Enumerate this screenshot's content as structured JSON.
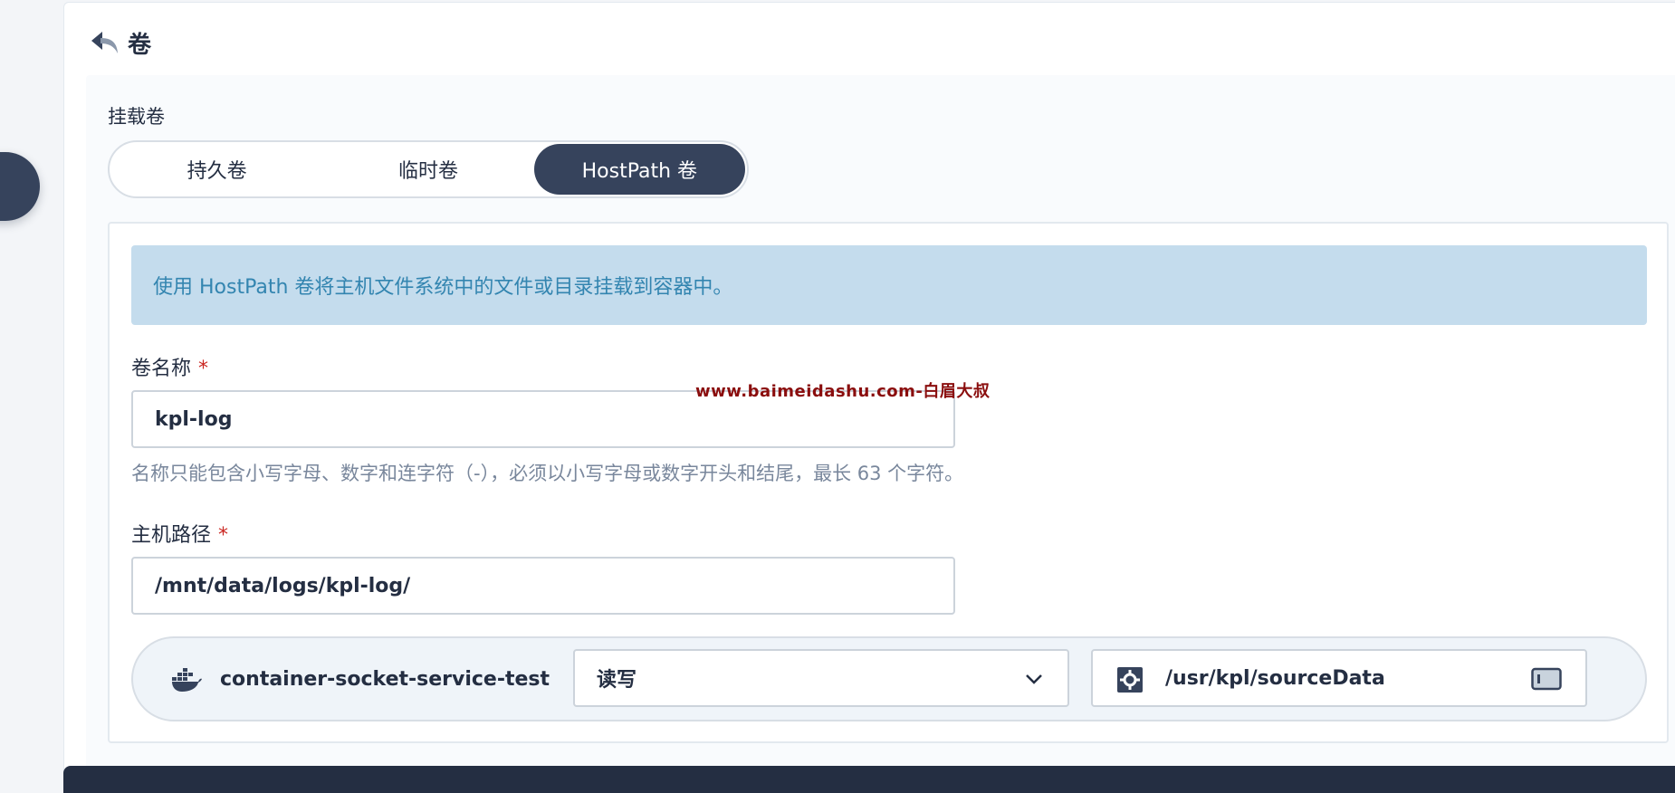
{
  "page": {
    "title": "卷"
  },
  "mount": {
    "section_label": "挂载卷",
    "tabs": [
      {
        "label": "持久卷",
        "active": false
      },
      {
        "label": "临时卷",
        "active": false
      },
      {
        "label": "HostPath 卷",
        "active": true
      }
    ]
  },
  "card": {
    "info": "使用 HostPath 卷将主机文件系统中的文件或目录挂载到容器中。",
    "volume_name": {
      "label": "卷名称",
      "required_mark": "*",
      "value": "kpl-log",
      "hint": "名称只能包含小写字母、数字和连字符（-），必须以小写字母或数字开头和结尾，最长 63 个字符。"
    },
    "host_path": {
      "label": "主机路径",
      "required_mark": "*",
      "value": "/mnt/data/logs/kpl-log/"
    },
    "container_mount": {
      "container_name": "container-socket-service-test",
      "access_mode": "读写",
      "mount_path": "/usr/kpl/sourceData"
    }
  },
  "watermark": "www.baimeidashu.com-白眉大叔",
  "icons": {
    "back": "back-arrow-icon",
    "docker": "docker-icon",
    "dropdown": "chevron-down-icon",
    "mount_path": "gear-icon",
    "terminal": "terminal-icon"
  },
  "colors": {
    "primary_dark": "#36435c",
    "info_bg": "#c4dced",
    "info_text": "#3385b0",
    "required": "#ca2621",
    "hint": "#79879c"
  }
}
